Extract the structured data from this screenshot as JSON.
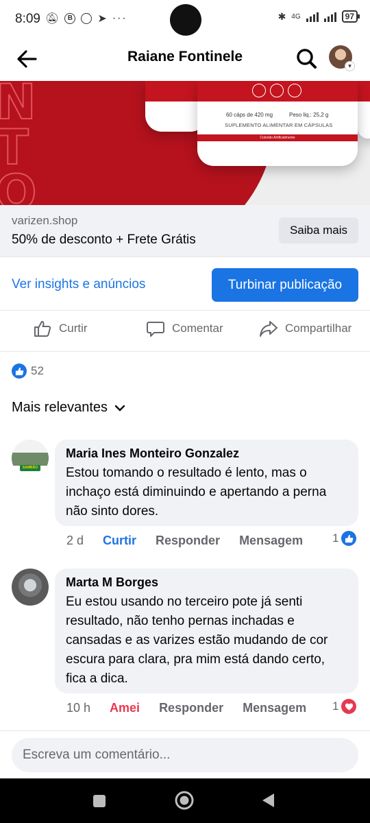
{
  "status_bar": {
    "time": "8:09",
    "network": "4G",
    "battery": "97"
  },
  "header": {
    "title": "Raiane Fontinele"
  },
  "ad": {
    "image_text": {
      "caps": "60 cáps de 420 mg",
      "weight": "Peso liq.: 25,2 g",
      "product": "SUPLEMENTO ALIMENTAR EM CÁPSULAS",
      "flavor": "Colorido Artificialmente"
    },
    "domain": "varizen.shop",
    "headline": "50% de desconto + Frete Grátis",
    "cta_label": "Saiba mais"
  },
  "post_actions": {
    "insights_label": "Ver insights e anúncios",
    "boost_label": "Turbinar publicação",
    "like_label": "Curtir",
    "comment_label": "Comentar",
    "share_label": "Compartilhar"
  },
  "reactions": {
    "count": "52"
  },
  "sort": {
    "label": "Mais relevantes"
  },
  "comments": [
    {
      "author": "Maria Ines Monteiro Gonzalez",
      "text": "Estou tomando o resultado é lento, mas o inchaço está diminuindo e apertando a perna não sinto dores.",
      "time": "2 d",
      "reaction_action": "Curtir",
      "reply": "Responder",
      "message": "Mensagem",
      "reaction_count": "1",
      "reaction_icon": "like-icon",
      "avatar_badge": "SAMBÃO"
    },
    {
      "author": "Marta M Borges",
      "text": "Eu estou usando no terceiro pote já senti resultado, não tenho pernas inchadas e cansadas e as varizes estão mudando de cor escura para clara, pra mim está dando certo, fica a dica.",
      "time": "10 h",
      "reaction_action": "Amei",
      "reply": "Responder",
      "message": "Mensagem",
      "reaction_count": "1",
      "reaction_icon": "heart-icon"
    }
  ],
  "composer": {
    "placeholder": "Escreva um comentário..."
  },
  "colors": {
    "accent_blue": "#1b74e4",
    "love_red": "#e8384f",
    "brand_red": "#b5121d",
    "bubble_bg": "#f0f2f5",
    "muted_text": "#65676b"
  }
}
